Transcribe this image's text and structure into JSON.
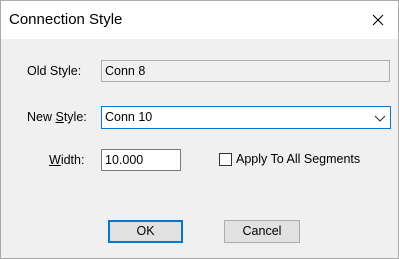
{
  "window": {
    "title": "Connection Style"
  },
  "form": {
    "old_style": {
      "label": "Old Style:",
      "value": "Conn 8"
    },
    "new_style": {
      "label_prefix": "New ",
      "label_accel": "S",
      "label_suffix": "tyle:",
      "value": "Conn 10"
    },
    "width": {
      "label_accel": "W",
      "label_suffix": "idth:",
      "value": "10.000"
    },
    "apply_all": {
      "label": "Apply To All Segments",
      "checked": false
    }
  },
  "buttons": {
    "ok_label": "OK",
    "cancel_label": "Cancel"
  },
  "icons": {
    "close": "close-icon",
    "dropdown": "chevron-down-icon"
  },
  "colors": {
    "accent": "#0078d7",
    "dialog_bg": "#f0f0f0",
    "titlebar_bg": "#ffffff"
  }
}
